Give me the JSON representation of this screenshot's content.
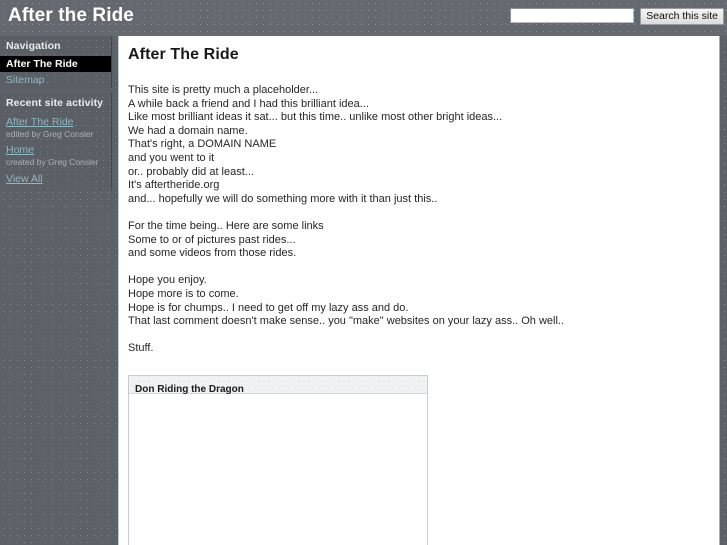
{
  "header": {
    "site_title": "After the Ride",
    "search_value": "",
    "search_placeholder": "",
    "search_button_label": "Search this site"
  },
  "sidebar": {
    "navigation": {
      "title": "Navigation",
      "items": [
        {
          "label": "After The Ride",
          "active": true
        },
        {
          "label": "Sitemap",
          "active": false
        }
      ]
    },
    "recent_activity": {
      "title": "Recent site activity",
      "entries": [
        {
          "link": "After The Ride",
          "meta": "edited by Greg Consler"
        },
        {
          "link": "Home",
          "meta": "created by Greg Consler"
        }
      ],
      "view_all_label": "View All"
    }
  },
  "main": {
    "page_title": "After The Ride",
    "paragraphs": [
      [
        "This site is pretty much a placeholder...",
        "A while back a friend and I had this brilliant idea...",
        "Like most brilliant ideas it sat... but this time.. unlike most other bright ideas...",
        "We had a domain name.",
        "That's right, a DOMAIN NAME",
        "and you went to it",
        "or.. probably did at least...",
        "It's aftertheride.org",
        "and... hopefully we will do something more with it than just this.."
      ],
      [
        "For the time being.. Here are some links",
        "Some to or of pictures past rides...",
        "and some videos from those rides."
      ],
      [
        "Hope you enjoy.",
        "Hope more is to come.",
        "Hope is for chumps.. I need to get off my lazy ass and do.",
        "That last comment doesn't make sense.. you \"make\" websites on your lazy ass.. Oh well.."
      ],
      [
        "Stuff."
      ]
    ],
    "embed_panel": {
      "title": "Don Riding the Dragon"
    }
  }
}
